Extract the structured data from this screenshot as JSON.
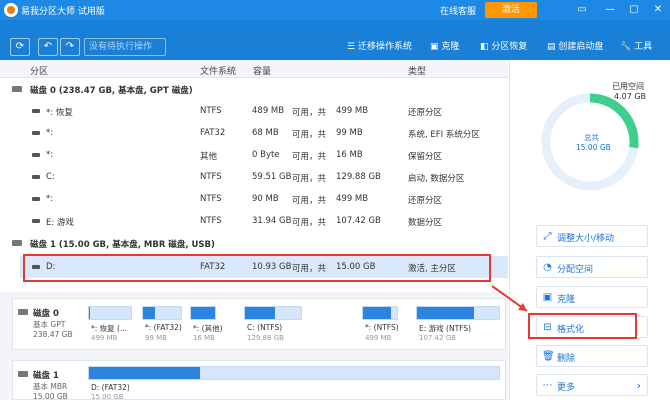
{
  "titlebar": {
    "title": "易我分区大师 试用版",
    "service": "在线客服",
    "activate": "激活",
    "controls": [
      "▭",
      "—",
      "▢",
      "✕"
    ]
  },
  "toolbar": {
    "undo": "↶",
    "redo": "↷",
    "refresh": "⟳",
    "pending": "没有待执行操作",
    "migrate": "迁移操作系统",
    "clone": "克隆",
    "recover": "分区恢复",
    "bootdisk": "创建启动盘",
    "tools": "工具"
  },
  "table": {
    "headers": [
      "分区",
      "文件系统",
      "容量",
      "类型"
    ],
    "disk0": "磁盘 0 (238.47 GB, 基本盘, GPT 磁盘)",
    "disk1": "磁盘 1 (15.00 GB, 基本盘, MBR 磁盘, USB)",
    "rows0": [
      {
        "name": "*: 恢复",
        "fs": "NTFS",
        "used": "489 MB",
        "sep": "可用，共",
        "total": "499 MB",
        "type": "还原分区"
      },
      {
        "name": "*:",
        "fs": "FAT32",
        "used": "68 MB",
        "sep": "可用，共",
        "total": "99 MB",
        "type": "系统, EFI 系统分区"
      },
      {
        "name": "*:",
        "fs": "其他",
        "used": "0 Byte",
        "sep": "可用，共",
        "total": "16 MB",
        "type": "保留分区"
      },
      {
        "name": "C:",
        "fs": "NTFS",
        "used": "59.51 GB",
        "sep": "可用，共",
        "total": "129.88 GB",
        "type": "启动, 数据分区"
      },
      {
        "name": "*:",
        "fs": "NTFS",
        "used": "90 MB",
        "sep": "可用，共",
        "total": "499 MB",
        "type": "还原分区"
      },
      {
        "name": "E: 游戏",
        "fs": "NTFS",
        "used": "31.94 GB",
        "sep": "可用，共",
        "total": "107.42 GB",
        "type": "数据分区"
      }
    ],
    "rows1": [
      {
        "name": "D:",
        "fs": "FAT32",
        "used": "10.93 GB",
        "sep": "可用，共",
        "total": "15.00 GB",
        "type": "激活, 主分区"
      }
    ]
  },
  "map": {
    "disk0": {
      "name": "磁盘 0",
      "type": "基本 GPT",
      "size": "238.47 GB"
    },
    "disk1": {
      "name": "磁盘 1",
      "type": "基本 MBR",
      "size": "15.00 GB"
    },
    "segs0": [
      {
        "label": "*: 恢复 (...",
        "size": "499 MB",
        "fill": 0.02
      },
      {
        "label": "*: (FAT32)",
        "size": "99 MB",
        "fill": 0.31
      },
      {
        "label": "*: (其他)",
        "size": "16 MB",
        "fill": 1.0
      },
      {
        "label": "C: (NTFS)",
        "size": "129.88 GB",
        "fill": 0.54
      },
      {
        "label": "*: (NTFS)",
        "size": "499 MB",
        "fill": 0.82
      },
      {
        "label": "E: 游戏 (NTFS)",
        "size": "107.42 GB",
        "fill": 0.7
      }
    ],
    "segs1": [
      {
        "label": "D: (FAT32)",
        "size": "15.00 GB",
        "fill": 0.27
      }
    ]
  },
  "usage": {
    "used_label": "已用空间",
    "used_value": "4.07 GB",
    "total_label": "总共",
    "total_value": "15.00 GB",
    "used_fraction": 0.27,
    "ring_color": "#3ecf8e",
    "track_color": "#e6f0fb"
  },
  "actions": [
    {
      "icon": "⤢",
      "label": "调整大小/移动"
    },
    {
      "icon": "◔",
      "label": "分配空间"
    },
    {
      "icon": "▣",
      "label": "克隆"
    },
    {
      "icon": "⊟",
      "label": "格式化"
    },
    {
      "icon": "🗑",
      "label": "删除"
    },
    {
      "icon": "⋯",
      "label": "更多",
      "chevron": "›"
    }
  ],
  "colors": {
    "accent": "#1a7fd6",
    "highlight": "#e53935",
    "selected_row": "#d9e9fb"
  }
}
